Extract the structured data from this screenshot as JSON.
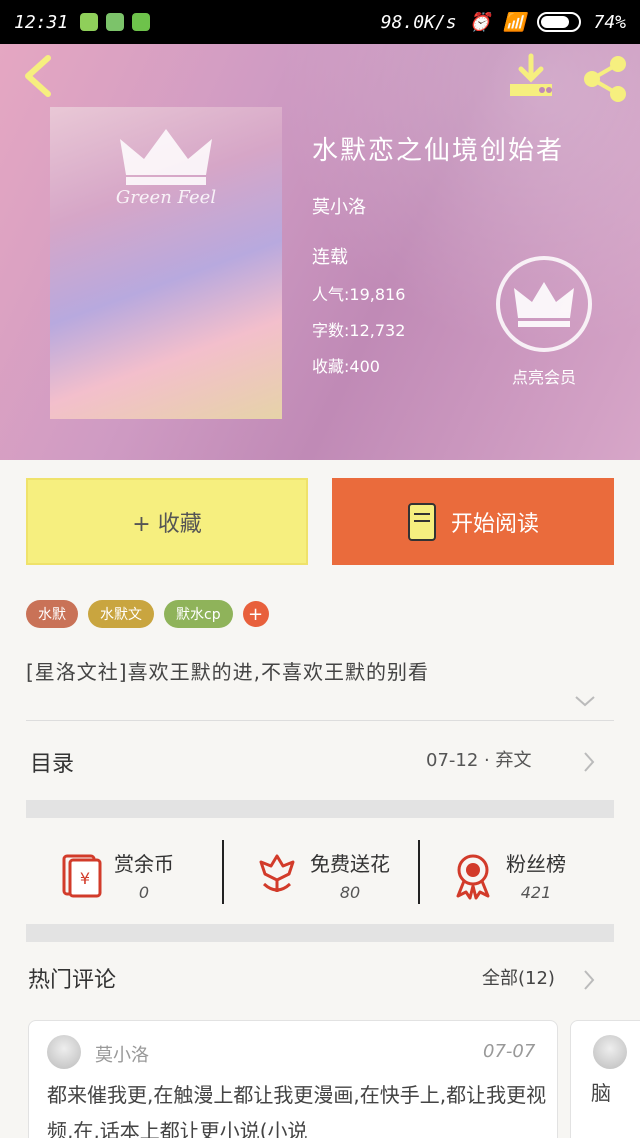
{
  "status": {
    "time": "12:31",
    "speed": "98.0K/s",
    "battery": "74%"
  },
  "book": {
    "title": "水默恋之仙境创始者",
    "author": "莫小洛",
    "state": "连载",
    "popularity": "人气:19,816",
    "words": "字数:12,732",
    "favorites": "收藏:400",
    "cover_text": "Green Feel"
  },
  "vip_label": "点亮会员",
  "actions": {
    "collect": "+ 收藏",
    "read": "开始阅读"
  },
  "tags": [
    {
      "label": "水默",
      "color": "#c97257"
    },
    {
      "label": "水默文",
      "color": "#c9a53f"
    },
    {
      "label": "默水cp",
      "color": "#8fb35a"
    }
  ],
  "tag_add": "+",
  "description": "[星洛文社]喜欢王默的进,不喜欢王默的别看",
  "toc": {
    "label": "目录",
    "right": "07-12 · 弃文"
  },
  "stats": [
    {
      "label": "赏余币",
      "value": "0"
    },
    {
      "label": "免费送花",
      "value": "80"
    },
    {
      "label": "粉丝榜",
      "value": "421"
    }
  ],
  "hot": {
    "label": "热门评论",
    "right": "全部(12)"
  },
  "comments": [
    {
      "name": "莫小洛",
      "date": "07-07",
      "text": "都来催我更,在触漫上都让我更漫画,在快手上,都让我更视频,在,话本上都让更小说(小说"
    },
    {
      "text": "脑"
    }
  ]
}
